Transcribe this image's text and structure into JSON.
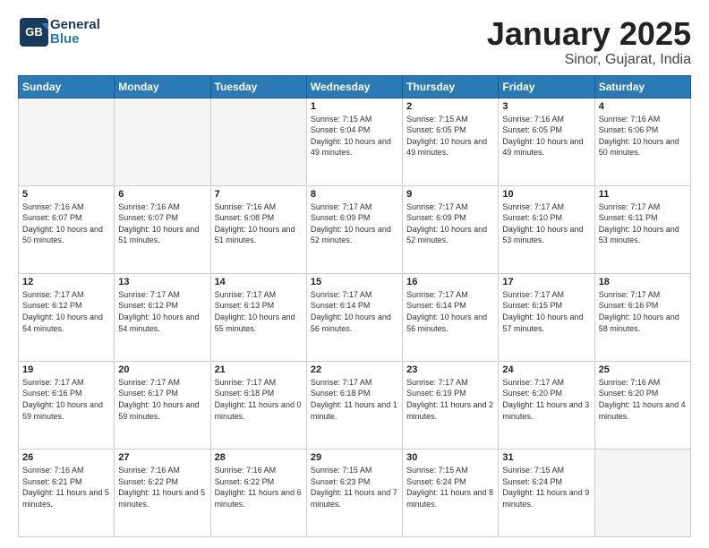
{
  "header": {
    "logo_general": "General",
    "logo_blue": "Blue",
    "month": "January 2025",
    "location": "Sinor, Gujarat, India"
  },
  "days_of_week": [
    "Sunday",
    "Monday",
    "Tuesday",
    "Wednesday",
    "Thursday",
    "Friday",
    "Saturday"
  ],
  "weeks": [
    [
      {
        "day": "",
        "sunrise": "",
        "sunset": "",
        "daylight": "",
        "empty": true
      },
      {
        "day": "",
        "sunrise": "",
        "sunset": "",
        "daylight": "",
        "empty": true
      },
      {
        "day": "",
        "sunrise": "",
        "sunset": "",
        "daylight": "",
        "empty": true
      },
      {
        "day": "1",
        "sunrise": "Sunrise: 7:15 AM",
        "sunset": "Sunset: 6:04 PM",
        "daylight": "Daylight: 10 hours and 49 minutes."
      },
      {
        "day": "2",
        "sunrise": "Sunrise: 7:15 AM",
        "sunset": "Sunset: 6:05 PM",
        "daylight": "Daylight: 10 hours and 49 minutes."
      },
      {
        "day": "3",
        "sunrise": "Sunrise: 7:16 AM",
        "sunset": "Sunset: 6:05 PM",
        "daylight": "Daylight: 10 hours and 49 minutes."
      },
      {
        "day": "4",
        "sunrise": "Sunrise: 7:16 AM",
        "sunset": "Sunset: 6:06 PM",
        "daylight": "Daylight: 10 hours and 50 minutes."
      }
    ],
    [
      {
        "day": "5",
        "sunrise": "Sunrise: 7:16 AM",
        "sunset": "Sunset: 6:07 PM",
        "daylight": "Daylight: 10 hours and 50 minutes."
      },
      {
        "day": "6",
        "sunrise": "Sunrise: 7:16 AM",
        "sunset": "Sunset: 6:07 PM",
        "daylight": "Daylight: 10 hours and 51 minutes."
      },
      {
        "day": "7",
        "sunrise": "Sunrise: 7:16 AM",
        "sunset": "Sunset: 6:08 PM",
        "daylight": "Daylight: 10 hours and 51 minutes."
      },
      {
        "day": "8",
        "sunrise": "Sunrise: 7:17 AM",
        "sunset": "Sunset: 6:09 PM",
        "daylight": "Daylight: 10 hours and 52 minutes."
      },
      {
        "day": "9",
        "sunrise": "Sunrise: 7:17 AM",
        "sunset": "Sunset: 6:09 PM",
        "daylight": "Daylight: 10 hours and 52 minutes."
      },
      {
        "day": "10",
        "sunrise": "Sunrise: 7:17 AM",
        "sunset": "Sunset: 6:10 PM",
        "daylight": "Daylight: 10 hours and 53 minutes."
      },
      {
        "day": "11",
        "sunrise": "Sunrise: 7:17 AM",
        "sunset": "Sunset: 6:11 PM",
        "daylight": "Daylight: 10 hours and 53 minutes."
      }
    ],
    [
      {
        "day": "12",
        "sunrise": "Sunrise: 7:17 AM",
        "sunset": "Sunset: 6:12 PM",
        "daylight": "Daylight: 10 hours and 54 minutes."
      },
      {
        "day": "13",
        "sunrise": "Sunrise: 7:17 AM",
        "sunset": "Sunset: 6:12 PM",
        "daylight": "Daylight: 10 hours and 54 minutes."
      },
      {
        "day": "14",
        "sunrise": "Sunrise: 7:17 AM",
        "sunset": "Sunset: 6:13 PM",
        "daylight": "Daylight: 10 hours and 55 minutes."
      },
      {
        "day": "15",
        "sunrise": "Sunrise: 7:17 AM",
        "sunset": "Sunset: 6:14 PM",
        "daylight": "Daylight: 10 hours and 56 minutes."
      },
      {
        "day": "16",
        "sunrise": "Sunrise: 7:17 AM",
        "sunset": "Sunset: 6:14 PM",
        "daylight": "Daylight: 10 hours and 56 minutes."
      },
      {
        "day": "17",
        "sunrise": "Sunrise: 7:17 AM",
        "sunset": "Sunset: 6:15 PM",
        "daylight": "Daylight: 10 hours and 57 minutes."
      },
      {
        "day": "18",
        "sunrise": "Sunrise: 7:17 AM",
        "sunset": "Sunset: 6:16 PM",
        "daylight": "Daylight: 10 hours and 58 minutes."
      }
    ],
    [
      {
        "day": "19",
        "sunrise": "Sunrise: 7:17 AM",
        "sunset": "Sunset: 6:16 PM",
        "daylight": "Daylight: 10 hours and 59 minutes."
      },
      {
        "day": "20",
        "sunrise": "Sunrise: 7:17 AM",
        "sunset": "Sunset: 6:17 PM",
        "daylight": "Daylight: 10 hours and 59 minutes."
      },
      {
        "day": "21",
        "sunrise": "Sunrise: 7:17 AM",
        "sunset": "Sunset: 6:18 PM",
        "daylight": "Daylight: 11 hours and 0 minutes."
      },
      {
        "day": "22",
        "sunrise": "Sunrise: 7:17 AM",
        "sunset": "Sunset: 6:18 PM",
        "daylight": "Daylight: 11 hours and 1 minute."
      },
      {
        "day": "23",
        "sunrise": "Sunrise: 7:17 AM",
        "sunset": "Sunset: 6:19 PM",
        "daylight": "Daylight: 11 hours and 2 minutes."
      },
      {
        "day": "24",
        "sunrise": "Sunrise: 7:17 AM",
        "sunset": "Sunset: 6:20 PM",
        "daylight": "Daylight: 11 hours and 3 minutes."
      },
      {
        "day": "25",
        "sunrise": "Sunrise: 7:16 AM",
        "sunset": "Sunset: 6:20 PM",
        "daylight": "Daylight: 11 hours and 4 minutes."
      }
    ],
    [
      {
        "day": "26",
        "sunrise": "Sunrise: 7:16 AM",
        "sunset": "Sunset: 6:21 PM",
        "daylight": "Daylight: 11 hours and 5 minutes."
      },
      {
        "day": "27",
        "sunrise": "Sunrise: 7:16 AM",
        "sunset": "Sunset: 6:22 PM",
        "daylight": "Daylight: 11 hours and 5 minutes."
      },
      {
        "day": "28",
        "sunrise": "Sunrise: 7:16 AM",
        "sunset": "Sunset: 6:22 PM",
        "daylight": "Daylight: 11 hours and 6 minutes."
      },
      {
        "day": "29",
        "sunrise": "Sunrise: 7:15 AM",
        "sunset": "Sunset: 6:23 PM",
        "daylight": "Daylight: 11 hours and 7 minutes."
      },
      {
        "day": "30",
        "sunrise": "Sunrise: 7:15 AM",
        "sunset": "Sunset: 6:24 PM",
        "daylight": "Daylight: 11 hours and 8 minutes."
      },
      {
        "day": "31",
        "sunrise": "Sunrise: 7:15 AM",
        "sunset": "Sunset: 6:24 PM",
        "daylight": "Daylight: 11 hours and 9 minutes."
      },
      {
        "day": "",
        "sunrise": "",
        "sunset": "",
        "daylight": "",
        "empty": true
      }
    ]
  ]
}
